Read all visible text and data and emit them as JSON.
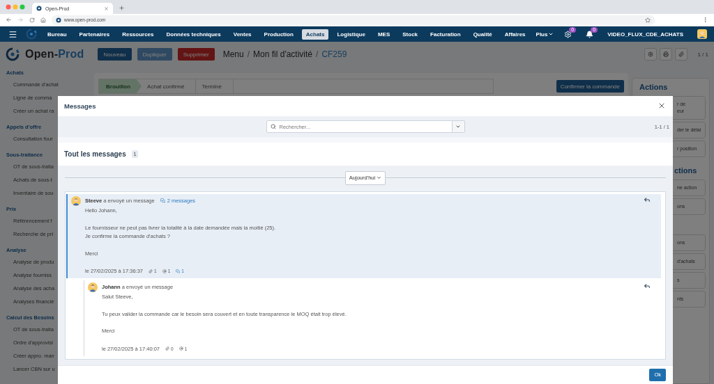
{
  "browser": {
    "tab_title": "Open-Prod",
    "url": "www.open-prod.com"
  },
  "nav": {
    "items": [
      {
        "label": "Bureau",
        "selected": false
      },
      {
        "label": "Partenaires",
        "selected": false
      },
      {
        "label": "Ressources",
        "selected": false
      },
      {
        "label": "Données techniques",
        "selected": false
      },
      {
        "label": "Ventes",
        "selected": false
      },
      {
        "label": "Production",
        "selected": false
      },
      {
        "label": "Achats",
        "selected": true
      },
      {
        "label": "Logistique",
        "selected": false
      },
      {
        "label": "MES",
        "selected": false
      },
      {
        "label": "Stock",
        "selected": false
      },
      {
        "label": "Facturation",
        "selected": false
      },
      {
        "label": "Qualité",
        "selected": false
      },
      {
        "label": "Affaires",
        "selected": false
      }
    ],
    "more": "Plus",
    "settings_badge": "0",
    "notifications_badge": "0",
    "user": "VIDEO_FLUX_CDE_ACHATS"
  },
  "toolbar": {
    "logo": {
      "dark": "Open-",
      "accent": "Prod"
    },
    "buttons": [
      {
        "label": "Nouveau",
        "kind": "primary"
      },
      {
        "label": "Dupliquer",
        "kind": "disabled"
      },
      {
        "label": "Supprimer",
        "kind": "danger"
      }
    ],
    "breadcrumb": {
      "items": [
        "Menu",
        "Mon fil d'activité",
        "CF259"
      ],
      "separator": "/"
    },
    "pager": "1 / 1"
  },
  "sidebar": {
    "sections": [
      {
        "title": "Achats",
        "items": [
          "Commande d'achat",
          "Ligne de comma",
          "Créer un achat ra"
        ]
      },
      {
        "title": "Appels d'offre",
        "items": [
          "Consultation four"
        ]
      },
      {
        "title": "Sous-traitance",
        "items": [
          "OT de sous-traita",
          "Achats de sous-t",
          "Inventaire de sou"
        ]
      },
      {
        "title": "Prix",
        "items": [
          "Référencement f",
          "Recherche de pri"
        ]
      },
      {
        "title": "Analyse",
        "items": [
          "Analyse de produ",
          "Analyse fourniss",
          "Analyse des acha",
          "Analyses financié"
        ]
      },
      {
        "title": "Calcul des Besoins",
        "items": [
          "OT de sous-traita",
          "Ordre d'approvisi",
          "Créer appro. man",
          "Lancer CBN sur u"
        ]
      }
    ]
  },
  "status": {
    "stages": [
      {
        "label": "Brouillon",
        "selected": true
      },
      {
        "label": "Achat confirmé",
        "selected": false
      },
      {
        "label": "Terminé",
        "selected": false
      }
    ],
    "confirm_button": "Confirmer la commande"
  },
  "actions_panel": {
    "sections": [
      {
        "title": "Actions",
        "buttons": [
          "r de\neur",
          "der le délai",
          "r position"
        ]
      },
      {
        "title": "ctions",
        "buttons": [
          "ne action",
          "ons"
        ]
      },
      {
        "buttons": [
          "ons",
          "d'achats",
          "s",
          "nts"
        ]
      }
    ]
  },
  "modal": {
    "title": "Messages",
    "search": {
      "placeholder": "Rechercher..."
    },
    "count": "1-1 / 1",
    "heading": "Tout les messages",
    "heading_badge": "1",
    "date_filter": "Aujourd'hui",
    "messages": [
      {
        "author_line": "**Steeve** a envoyé un message",
        "thread_link": "2 messages",
        "highlighted": true,
        "paragraphs": [
          [
            "Hello Johann,"
          ],
          [
            "Le fournisseur ne peut pas livrer la totalité à la date demandée mais la moitié (25).",
            "Je confirme la commande d'achats ?"
          ],
          [
            "Merci"
          ]
        ],
        "date": "le 27/02/2025 à 17:36:37",
        "stats": [
          {
            "kind": "attachments",
            "count": "1"
          },
          {
            "kind": "mentions",
            "count": "1"
          },
          {
            "kind": "replies",
            "count": "1"
          }
        ],
        "children": [
          {
            "author_line": "**Johann** a envoyé un message",
            "highlighted": false,
            "paragraphs": [
              [
                "Salut Steeve,"
              ],
              [
                "Tu peux valider la commande car le besoin sera couvert et en toute transparence le MOQ était trop élevé."
              ],
              [
                "Merci"
              ]
            ],
            "date": "le 27/02/2025 à 17:40:07",
            "stats": [
              {
                "kind": "attachments",
                "count": "0"
              },
              {
                "kind": "mentions",
                "count": "1"
              }
            ]
          }
        ]
      }
    ],
    "ok_button": "Ok"
  }
}
